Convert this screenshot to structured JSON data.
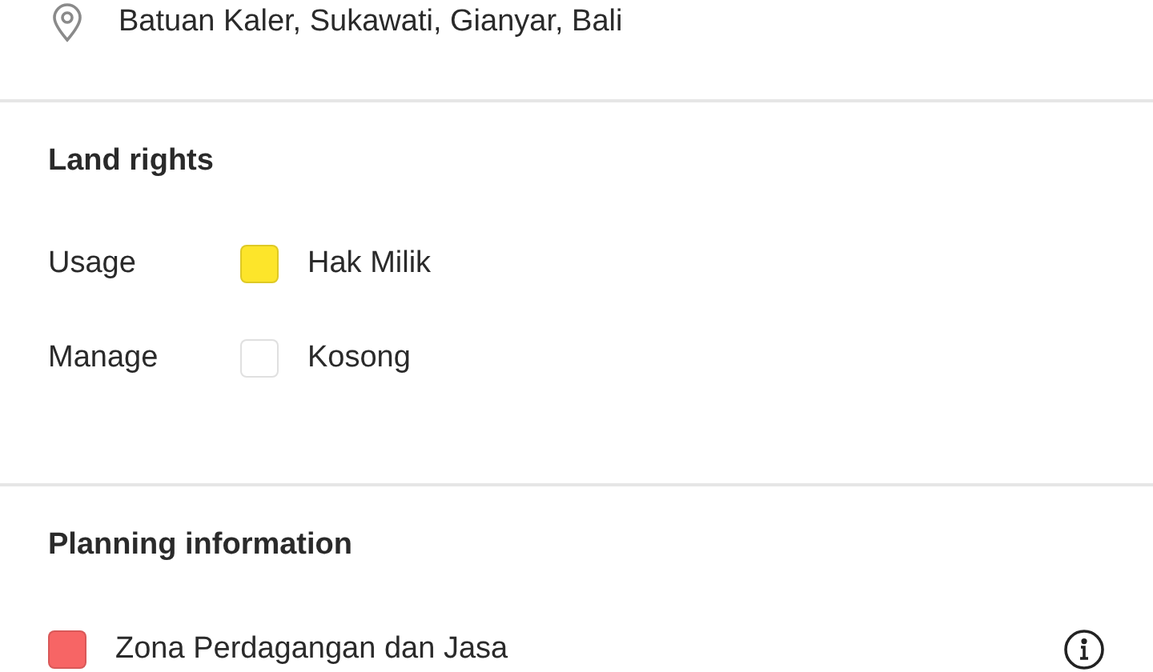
{
  "address": "Batuan Kaler, Sukawati, Gianyar, Bali",
  "land_rights": {
    "title": "Land rights",
    "rows": [
      {
        "label": "Usage",
        "color": "#fde52a",
        "value": "Hak Milik"
      },
      {
        "label": "Manage",
        "color": "#ffffff",
        "value": "Kosong"
      }
    ]
  },
  "planning": {
    "title": "Planning information",
    "items": [
      {
        "color": "#f76565",
        "value": "Zona Perdagangan dan Jasa"
      }
    ]
  }
}
